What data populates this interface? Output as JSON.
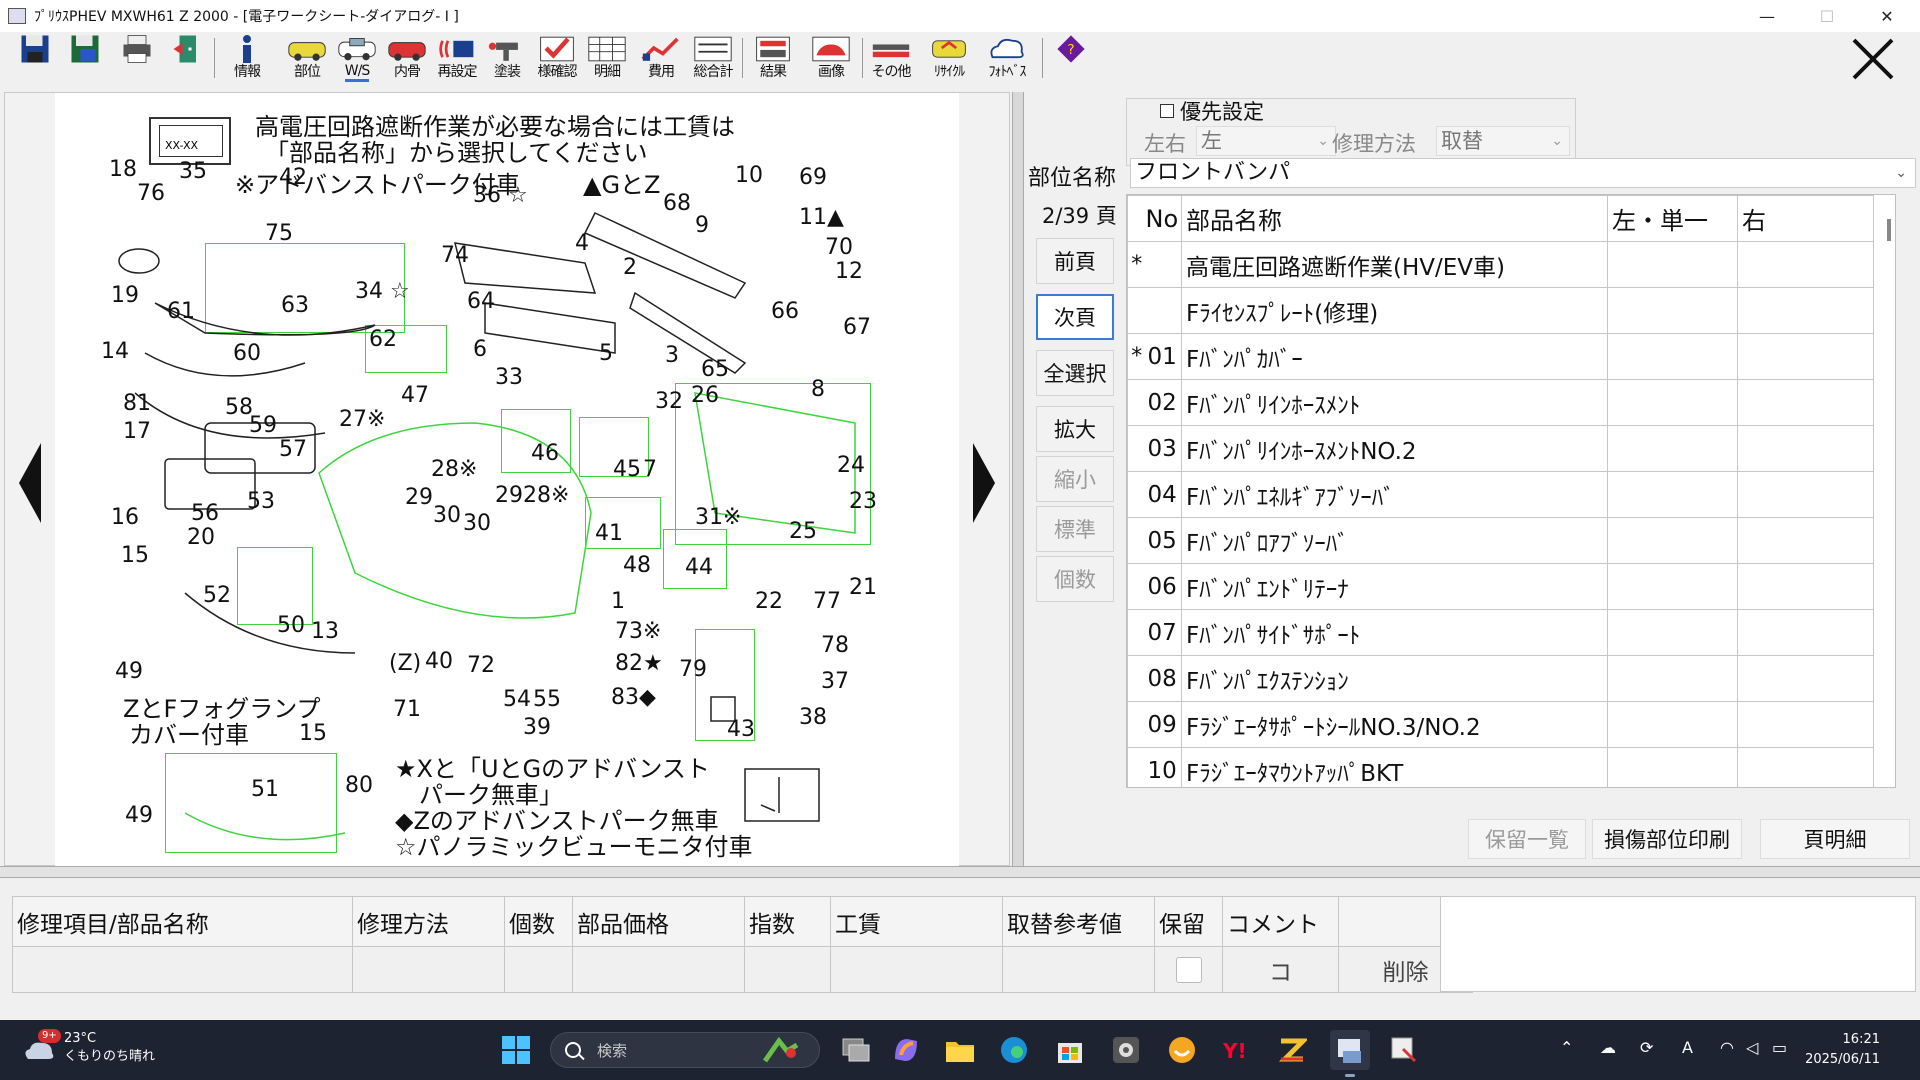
{
  "window": {
    "title": "ﾌﾟﾘｳｽPHEV MXWH61 Z 2000 - [電子ワークシート-ダイアログ- I ]",
    "minimize": "—",
    "maximize": "☐",
    "close": "✕"
  },
  "toolbar": {
    "items": [
      {
        "label": ""
      },
      {
        "label": ""
      },
      {
        "label": ""
      },
      {
        "label": ""
      },
      {
        "label": "情報"
      },
      {
        "label": "部位"
      },
      {
        "label": "W/S"
      },
      {
        "label": "内骨"
      },
      {
        "label": "再設定"
      },
      {
        "label": "塗装"
      },
      {
        "label": "様確認"
      },
      {
        "label": "明細"
      },
      {
        "label": "費用"
      },
      {
        "label": "総合計"
      },
      {
        "label": "結果"
      },
      {
        "label": "画像"
      },
      {
        "label": "その他"
      },
      {
        "label": "ﾘｻｲｸﾙ"
      },
      {
        "label": "ﾌｫﾄﾍﾞｽ"
      },
      {
        "label": ""
      }
    ]
  },
  "diagram": {
    "plate_label": "XX-XX",
    "note_line1": "高電圧回路遮断作業が必要な場合には工賃は",
    "note_line2": "「部品名称」から選択してください",
    "note_advanced": "※アドバンストパーク付車",
    "note_gz": "▲GとZ",
    "fog_line1": "ZとFフォグランプ",
    "fog_line2": "カバー付車",
    "z_label": "(Z)",
    "legend": [
      "★Xと「UとGのアドバンスト",
      "　パーク無車」",
      "◆Zのアドバンストパーク無車",
      "☆パノラミックビューモニタ付車"
    ],
    "callouts": [
      {
        "t": "18"
      },
      {
        "t": "35"
      },
      {
        "t": "42"
      },
      {
        "t": "76"
      },
      {
        "t": "75"
      },
      {
        "t": "19"
      },
      {
        "t": "63"
      },
      {
        "t": "61"
      },
      {
        "t": "60"
      },
      {
        "t": "14"
      },
      {
        "t": "81"
      },
      {
        "t": "58"
      },
      {
        "t": "17"
      },
      {
        "t": "59"
      },
      {
        "t": "57"
      },
      {
        "t": "27※"
      },
      {
        "t": "47"
      },
      {
        "t": "16"
      },
      {
        "t": "56"
      },
      {
        "t": "53"
      },
      {
        "t": "15"
      },
      {
        "t": "20"
      },
      {
        "t": "52"
      },
      {
        "t": "49"
      },
      {
        "t": "50"
      },
      {
        "t": "13"
      },
      {
        "t": "40"
      },
      {
        "t": "72"
      },
      {
        "t": "71"
      },
      {
        "t": "54"
      },
      {
        "t": "55"
      },
      {
        "t": "39"
      },
      {
        "t": "36 ☆"
      },
      {
        "t": "74"
      },
      {
        "t": "34 ☆"
      },
      {
        "t": "62"
      },
      {
        "t": "6"
      },
      {
        "t": "64"
      },
      {
        "t": "4"
      },
      {
        "t": "5"
      },
      {
        "t": "33"
      },
      {
        "t": "46"
      },
      {
        "t": "45"
      },
      {
        "t": "32"
      },
      {
        "t": "28※"
      },
      {
        "t": "29"
      },
      {
        "t": "30"
      },
      {
        "t": "30"
      },
      {
        "t": "29"
      },
      {
        "t": "28※"
      },
      {
        "t": "41"
      },
      {
        "t": "7"
      },
      {
        "t": "48"
      },
      {
        "t": "1"
      },
      {
        "t": "73※"
      },
      {
        "t": "82★"
      },
      {
        "t": "83◆"
      },
      {
        "t": "68"
      },
      {
        "t": "10"
      },
      {
        "t": "69"
      },
      {
        "t": "11▲"
      },
      {
        "t": "9"
      },
      {
        "t": "70"
      },
      {
        "t": "2"
      },
      {
        "t": "12"
      },
      {
        "t": "66"
      },
      {
        "t": "67"
      },
      {
        "t": "3"
      },
      {
        "t": "65"
      },
      {
        "t": "8"
      },
      {
        "t": "26"
      },
      {
        "t": "24"
      },
      {
        "t": "23"
      },
      {
        "t": "25"
      },
      {
        "t": "31※"
      },
      {
        "t": "44"
      },
      {
        "t": "22"
      },
      {
        "t": "77"
      },
      {
        "t": "21"
      },
      {
        "t": "79"
      },
      {
        "t": "78"
      },
      {
        "t": "37"
      },
      {
        "t": "43"
      },
      {
        "t": "38"
      },
      {
        "t": "15"
      },
      {
        "t": "51"
      },
      {
        "t": "49"
      },
      {
        "t": "80"
      }
    ]
  },
  "panel": {
    "priority_label": "優先設定",
    "side_label": "左右",
    "side_value": "左",
    "method_label": "修理方法",
    "method_value": "取替",
    "part_name_label": "部位名称",
    "part_name_value": "フロントバンパ",
    "page_indicator": "2/39 頁",
    "side_buttons": [
      "前頁",
      "次頁",
      "全選択",
      "拡大",
      "縮小",
      "標準",
      "個数"
    ],
    "table": {
      "headers": [
        "No",
        "部品名称",
        "左・単一",
        "右"
      ],
      "rows": [
        {
          "mark": "*",
          "no": "",
          "name": "高電圧回路遮断作業(HV/EV車)"
        },
        {
          "mark": "",
          "no": "",
          "name": "Fﾗｲｾﾝｽﾌﾟﾚｰﾄ(修理)"
        },
        {
          "mark": "*",
          "no": "01",
          "name": "Fﾊﾞﾝﾊﾟｶﾊﾞｰ"
        },
        {
          "mark": "",
          "no": "02",
          "name": "Fﾊﾞﾝﾊﾟﾘｲﾝﾎｰｽﾒﾝﾄ"
        },
        {
          "mark": "",
          "no": "03",
          "name": "FﾊﾞﾝﾊﾟﾘｲﾝﾎｰｽﾒﾝﾄNO.2"
        },
        {
          "mark": "",
          "no": "04",
          "name": "Fﾊﾞﾝﾊﾟｴﾈﾙｷﾞｱﾌﾞｿｰﾊﾞ"
        },
        {
          "mark": "",
          "no": "05",
          "name": "Fﾊﾞﾝﾊﾟﾛｱﾌﾞｿｰﾊﾞ"
        },
        {
          "mark": "",
          "no": "06",
          "name": "Fﾊﾞﾝﾊﾟｴﾝﾄﾞﾘﾃｰﾅ"
        },
        {
          "mark": "",
          "no": "07",
          "name": "Fﾊﾞﾝﾊﾟｻｲﾄﾞｻﾎﾟｰﾄ"
        },
        {
          "mark": "",
          "no": "08",
          "name": "Fﾊﾞﾝﾊﾟｴｸｽﾃﾝｼｮﾝ"
        },
        {
          "mark": "",
          "no": "09",
          "name": "FﾗｼﾞｴｰﾀｻﾎﾟｰﾄｼｰﾙNO.3/NO.2"
        },
        {
          "mark": "",
          "no": "10",
          "name": "FﾗｼﾞｴｰﾀﾏｳﾝﾄｱｯﾊﾟBKT"
        }
      ]
    },
    "bottom_buttons": [
      "保留一覧",
      "損傷部位印刷",
      "頁明細"
    ]
  },
  "lower": {
    "headers": [
      "修理項目/部品名称",
      "修理方法",
      "個数",
      "部品価格",
      "指数",
      "工賃",
      "取替参考値",
      "保留",
      "コメント",
      ""
    ],
    "comment_button": "コ",
    "delete_button": "削除"
  },
  "taskbar": {
    "weather_badge": "9+",
    "weather_temp": "23°C",
    "weather_desc": "くもりのち晴れ",
    "search_placeholder": "検索",
    "ime": "A",
    "time": "16:21",
    "date": "2025/06/11"
  },
  "colors": {
    "accent": "#3a6fd8",
    "highlight_green": "#3cd63c",
    "taskbar": "#1d2330"
  }
}
